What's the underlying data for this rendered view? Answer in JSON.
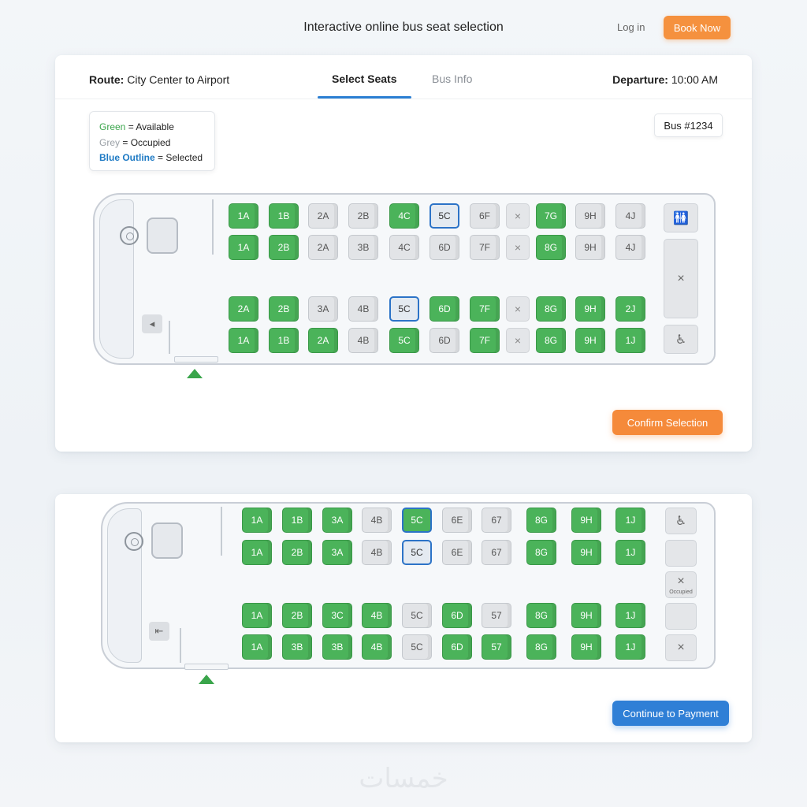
{
  "header": {
    "title": "Interactive online bus seat selection",
    "login_label": "Log in",
    "book_label": "Book Now"
  },
  "card1": {
    "route_label": "Route:",
    "route_value": "City Center to Airport",
    "tabs": [
      {
        "label": "Select Seats",
        "active": true
      },
      {
        "label": "Bus Info",
        "active": false
      }
    ],
    "departure_label": "Departure:",
    "departure_value": "10:00 AM",
    "legend": {
      "green": "Green",
      "green_desc": "= Available",
      "grey": "Grey",
      "grey_desc": "= Occupied",
      "blue": "Blue Outline",
      "blue_desc": "= Selected"
    },
    "bus_label": "Bus #1234",
    "confirm_label": "Confirm Selection",
    "rows": [
      [
        [
          "1A",
          "available"
        ],
        [
          "1B",
          "available"
        ],
        [
          "2A",
          "occupied"
        ],
        [
          "2B",
          "occupied"
        ],
        [
          "4C",
          "available"
        ],
        [
          "5C",
          "selected-blue"
        ],
        [
          "6F",
          "occupied"
        ],
        [
          "×",
          "blocked"
        ],
        [
          "7G",
          "available"
        ],
        [
          "9H",
          "occupied"
        ],
        [
          "4J",
          "occupied"
        ]
      ],
      [
        [
          "1A",
          "available"
        ],
        [
          "2B",
          "available"
        ],
        [
          "2A",
          "occupied"
        ],
        [
          "3B",
          "occupied"
        ],
        [
          "4C",
          "occupied"
        ],
        [
          "6D",
          "occupied"
        ],
        [
          "7F",
          "occupied"
        ],
        [
          "×",
          "blocked"
        ],
        [
          "8G",
          "available"
        ],
        [
          "9H",
          "occupied"
        ],
        [
          "4J",
          "occupied"
        ]
      ],
      [
        [
          "2A",
          "available"
        ],
        [
          "2B",
          "available"
        ],
        [
          "3A",
          "occupied"
        ],
        [
          "4B",
          "occupied"
        ],
        [
          "5C",
          "selected-blue"
        ],
        [
          "6D",
          "available"
        ],
        [
          "7F",
          "available"
        ],
        [
          "×",
          "blocked"
        ],
        [
          "8G",
          "available"
        ],
        [
          "9H",
          "available"
        ],
        [
          "2J",
          "available"
        ]
      ],
      [
        [
          "1A",
          "available"
        ],
        [
          "1B",
          "available"
        ],
        [
          "2A",
          "available"
        ],
        [
          "4B",
          "occupied"
        ],
        [
          "5C",
          "available"
        ],
        [
          "6D",
          "occupied"
        ],
        [
          "7F",
          "available"
        ],
        [
          "×",
          "blocked"
        ],
        [
          "8G",
          "available"
        ],
        [
          "9H",
          "available"
        ],
        [
          "1J",
          "available"
        ]
      ]
    ],
    "side_icons": [
      "restroom-icon",
      "blocked-area",
      "wheelchair-icon"
    ],
    "side_glyphs": [
      "🚻",
      "×",
      "♿"
    ]
  },
  "card2": {
    "continue_label": "Continue to Payment",
    "rows": [
      [
        [
          "1A",
          "available"
        ],
        [
          "1B",
          "available"
        ],
        [
          "3A",
          "available"
        ],
        [
          "4B",
          "occupied"
        ],
        [
          "5C",
          "selected-green"
        ],
        [
          "6E",
          "occupied"
        ],
        [
          "67",
          "occupied"
        ],
        [
          "8G",
          "available"
        ],
        [
          "9H",
          "available"
        ],
        [
          "1J",
          "available"
        ]
      ],
      [
        [
          "1A",
          "available"
        ],
        [
          "2B",
          "available"
        ],
        [
          "3A",
          "available"
        ],
        [
          "4B",
          "occupied"
        ],
        [
          "5C",
          "selected-blue"
        ],
        [
          "6E",
          "occupied"
        ],
        [
          "67",
          "occupied"
        ],
        [
          "8G",
          "available"
        ],
        [
          "9H",
          "available"
        ],
        [
          "1J",
          "available"
        ]
      ],
      [
        [
          "1A",
          "available"
        ],
        [
          "2B",
          "available"
        ],
        [
          "3C",
          "available"
        ],
        [
          "4B",
          "available"
        ],
        [
          "5C",
          "occupied"
        ],
        [
          "6D",
          "available"
        ],
        [
          "57",
          "occupied"
        ],
        [
          "8G",
          "available"
        ],
        [
          "9H",
          "available"
        ],
        [
          "1J",
          "available"
        ]
      ],
      [
        [
          "1A",
          "available"
        ],
        [
          "3B",
          "available"
        ],
        [
          "3B",
          "available"
        ],
        [
          "4B",
          "available"
        ],
        [
          "5C",
          "occupied"
        ],
        [
          "6D",
          "available"
        ],
        [
          "57",
          "available"
        ],
        [
          "8G",
          "available"
        ],
        [
          "9H",
          "available"
        ],
        [
          "1J",
          "available"
        ]
      ]
    ],
    "side_glyphs": [
      "♿",
      "",
      "×",
      "",
      "×"
    ],
    "occupied_label": "Occupied"
  },
  "watermark": "خمسات",
  "colors": {
    "available": "#4bb35a",
    "occupied": "#e2e4e7",
    "selected_outline": "#2c73c7",
    "accent_orange": "#f5913e",
    "accent_blue": "#2f7fd6"
  }
}
